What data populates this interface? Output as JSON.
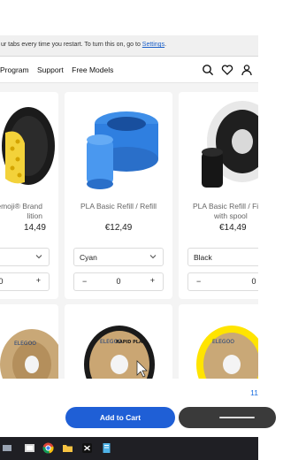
{
  "notice": {
    "text": "ur tabs every time you restart. To turn this on, go to ",
    "link": "Settings",
    "suffix": "."
  },
  "nav": {
    "links": [
      "Program",
      "Support",
      "Free Models"
    ]
  },
  "products": [
    {
      "name_line1": "emoji® Brand",
      "name_line2": "lition",
      "price": "14,49",
      "option": "",
      "qty": "0"
    },
    {
      "name_line1": "PLA Basic Refill / Refill",
      "name_line2": "",
      "price": "€12,49",
      "option": "Cyan",
      "qty": "0"
    },
    {
      "name_line1": "PLA Basic Refill / Fila",
      "name_line2": "with spool",
      "price": "€14,49",
      "option": "Black",
      "qty": "0"
    }
  ],
  "spool_brand": "ELEGOO",
  "spool_label": "RAPID PLA+",
  "bottom": {
    "count_text": "11",
    "add_to_cart": "Add to Cart"
  },
  "icons": {
    "nav": [
      "search-icon",
      "heart-icon",
      "user-icon"
    ],
    "select": "chevron-down-icon",
    "stepper": [
      "minus-icon",
      "plus-icon"
    ]
  },
  "colors": {
    "primary_button": "#1f5fd6",
    "link": "#1a5fc9",
    "filament_cyan": "#2f7fe0",
    "filament_yellow": "#ffe400",
    "taskbar": "#1f1f24"
  }
}
